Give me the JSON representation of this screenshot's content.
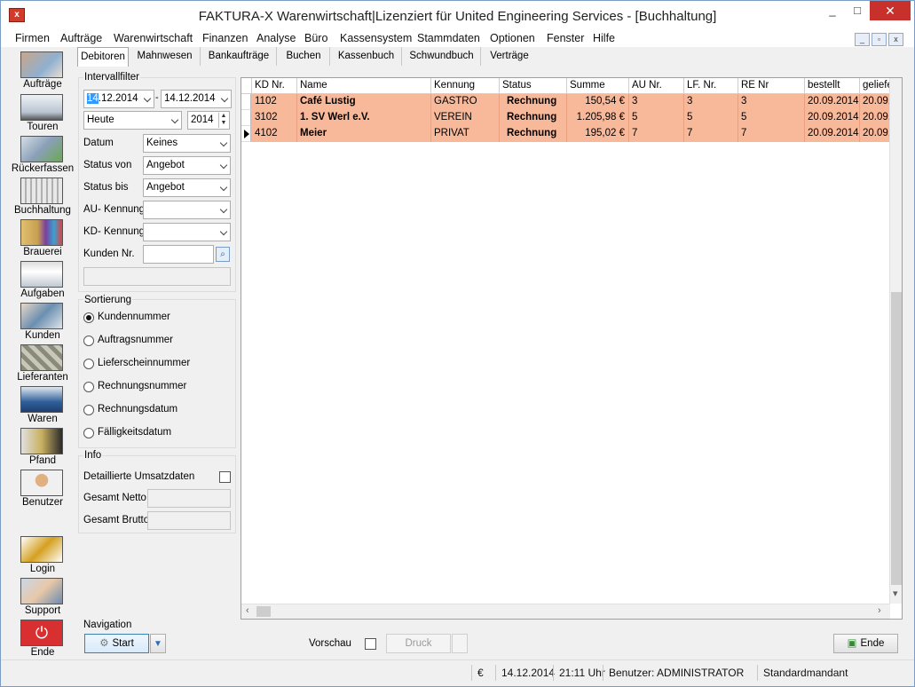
{
  "window": {
    "title": "FAKTURA-X Warenwirtschaft|Lizenziert für United Engineering Services - [Buchhaltung]",
    "min_glyph": "_",
    "max_glyph": "□",
    "close_glyph": "✕"
  },
  "menu": [
    "Firmen",
    "Aufträge",
    "Warenwirtschaft",
    "Finanzen",
    "Analyse",
    "Büro",
    "Kassensystem",
    "Stammdaten",
    "Optionen",
    "Fenster",
    "Hilfe"
  ],
  "toolbar": [
    {
      "label": "Aufträge",
      "icon": "customer-service-icon"
    },
    {
      "label": "Touren",
      "icon": "truck-icon"
    },
    {
      "label": "Rückerfassen",
      "icon": "return-truck-icon"
    },
    {
      "label": "Buchhaltung",
      "icon": "bookkeeping-icon"
    },
    {
      "label": "Brauerei",
      "icon": "brewery-icon"
    },
    {
      "label": "Aufgaben",
      "icon": "tasks-icon"
    },
    {
      "label": "Kunden",
      "icon": "customers-icon"
    },
    {
      "label": "Lieferanten",
      "icon": "suppliers-icon"
    },
    {
      "label": "Waren",
      "icon": "goods-icon"
    },
    {
      "label": "Pfand",
      "icon": "deposit-icon"
    },
    {
      "label": "Benutzer",
      "icon": "user-icon"
    },
    {
      "label": "Login",
      "icon": "key-icon"
    },
    {
      "label": "Support",
      "icon": "handshake-icon"
    },
    {
      "label": "Ende",
      "icon": "power-icon"
    }
  ],
  "tabs": [
    "Debitoren",
    "Mahnwesen",
    "Bankaufträge",
    "Buchen",
    "Kassenbuch",
    "Schwundbuch",
    "Verträge"
  ],
  "filter": {
    "interval_label": "Intervallfilter",
    "date_from_sel": "14",
    "date_from_rest": ".12.2014",
    "date_to": "14.12.2014",
    "period": "Heute",
    "year": "2014",
    "datum_label": "Datum",
    "datum_value": "Keines",
    "status_von_label": "Status von",
    "status_von_value": "Angebot",
    "status_bis_label": "Status bis",
    "status_bis_value": "Angebot",
    "au_kennung_label": "AU- Kennung",
    "au_kennung_value": "",
    "kd_kennung_label": "KD- Kennung",
    "kd_kennung_value": "",
    "kunden_nr_label": "Kunden Nr.",
    "kunden_nr_value": ""
  },
  "sort": {
    "label": "Sortierung",
    "options": [
      "Kundennummer",
      "Auftragsnummer",
      "Lieferscheinnummer",
      "Rechnungsnummer",
      "Rechnungsdatum",
      "Fälligkeitsdatum"
    ],
    "selected": 0
  },
  "info": {
    "label": "Info",
    "detail_label": "Detaillierte Umsatzdaten",
    "netto_label": "Gesamt Netto",
    "brutto_label": "Gesamt Brutto"
  },
  "grid": {
    "columns": [
      "KD Nr.",
      "Name",
      "Kennung",
      "Status",
      "Summe",
      "AU Nr.",
      "LF. Nr.",
      "RE Nr",
      "bestellt",
      "geliefe"
    ],
    "rows": [
      [
        "1102",
        "Café Lustig",
        "GASTRO",
        "Rechnung",
        "150,54 €",
        "3",
        "3",
        "3",
        "20.09.2014",
        "20.09."
      ],
      [
        "3102",
        "1. SV Werl e.V.",
        "VEREIN",
        "Rechnung",
        "1.205,98 €",
        "5",
        "5",
        "5",
        "20.09.2014",
        "20.09."
      ],
      [
        "4102",
        "Meier",
        "PRIVAT",
        "Rechnung",
        "195,02 €",
        "7",
        "7",
        "7",
        "20.09.2014",
        "20.09."
      ]
    ],
    "current_row": 2,
    "row_color": "#f8b89a"
  },
  "navigation": {
    "label": "Navigation",
    "start": "Start",
    "preview": "Vorschau",
    "print": "Druck",
    "end": "Ende"
  },
  "status": {
    "currency": "€",
    "date": "14.12.2014",
    "time": "21:11 Uhr",
    "user": "Benutzer: ADMINISTRATOR",
    "tenant": "Standardmandant"
  }
}
